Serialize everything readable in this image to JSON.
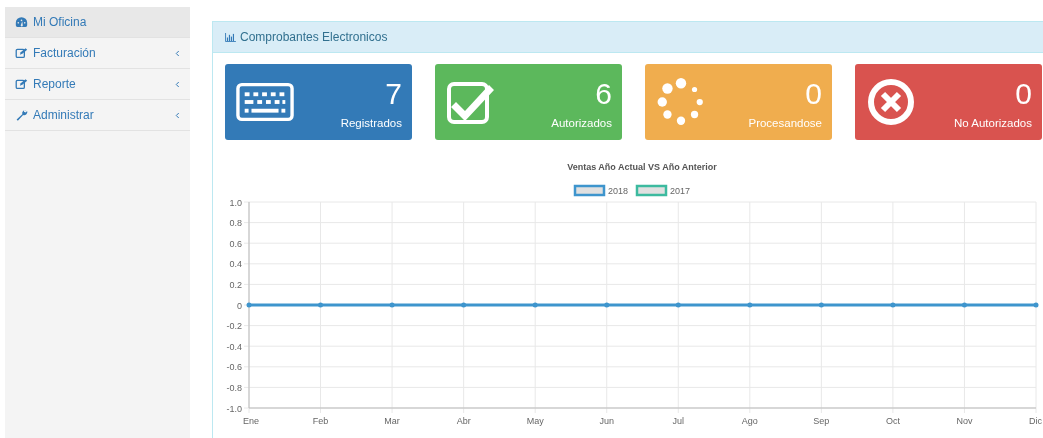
{
  "sidebar": {
    "items": [
      {
        "label": "Mi Oficina",
        "kind": "gauge",
        "selected": true,
        "expandable": false
      },
      {
        "label": "Facturación",
        "kind": "edit",
        "selected": false,
        "expandable": true
      },
      {
        "label": "Reporte",
        "kind": "edit",
        "selected": false,
        "expandable": true
      },
      {
        "label": "Administrar",
        "kind": "wrench",
        "selected": false,
        "expandable": true
      }
    ]
  },
  "panel": {
    "title": "Comprobantes Electronicos",
    "cards": [
      {
        "value": "7",
        "label": "Registrados",
        "kind": "keyboard",
        "color": "#337ab7"
      },
      {
        "value": "6",
        "label": "Autorizados",
        "kind": "check",
        "color": "#5cb85c"
      },
      {
        "value": "0",
        "label": "Procesandose",
        "kind": "spinner",
        "color": "#f0ad4e"
      },
      {
        "value": "0",
        "label": "No Autorizados",
        "kind": "times",
        "color": "#d9534f"
      }
    ],
    "chart_data": {
      "type": "line",
      "title": "Ventas Año Actual VS Año Anterior",
      "grid": true,
      "legend": true,
      "categories": [
        "Ene",
        "Feb",
        "Mar",
        "Abr",
        "May",
        "Jun",
        "Jul",
        "Ago",
        "Sep",
        "Oct",
        "Nov",
        "Dic"
      ],
      "series": [
        {
          "name": "2018",
          "color": "#3e95cd",
          "values": [
            0,
            0,
            0,
            0,
            0,
            0,
            0,
            0,
            0,
            0,
            0,
            0
          ]
        },
        {
          "name": "2017",
          "color": "#3cba9f",
          "values": [
            null,
            null,
            null,
            null,
            null,
            null,
            null,
            null,
            null,
            null,
            null,
            null
          ]
        }
      ],
      "ylim": [
        -1,
        1
      ],
      "yticks": [
        {
          "value": 1,
          "label": "1.0"
        },
        {
          "value": 0.8,
          "label": "0.8"
        },
        {
          "value": 0.6,
          "label": "0.6"
        },
        {
          "value": 0.4,
          "label": "0.4"
        },
        {
          "value": 0.2,
          "label": "0.2"
        },
        {
          "value": 0,
          "label": "0"
        },
        {
          "value": -0.2,
          "label": "-0.2"
        },
        {
          "value": -0.4,
          "label": "-0.4"
        },
        {
          "value": -0.6,
          "label": "-0.6"
        },
        {
          "value": -0.8,
          "label": "-0.8"
        },
        {
          "value": -1,
          "label": "-1.0"
        }
      ]
    }
  }
}
